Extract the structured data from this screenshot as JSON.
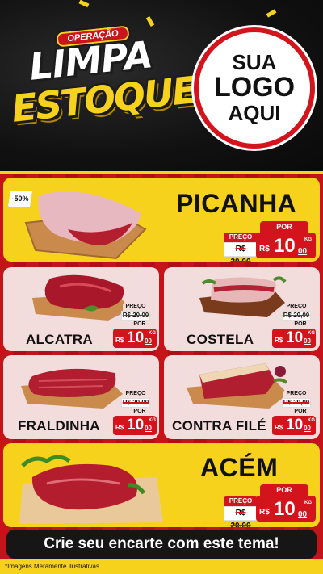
{
  "header": {
    "badge": "OPERAÇÃO",
    "title_line1": "LIMPA",
    "title_line2": "ESTOQUE",
    "logo_line1": "SUA",
    "logo_line2": "LOGO",
    "logo_line3": "AQUI"
  },
  "discount_badge": "-50%",
  "products": [
    {
      "name": "PICANHA",
      "preco_label": "PREÇO",
      "old_price": "R$ 20,00",
      "por_label": "POR",
      "currency": "R$",
      "price_int": "10",
      "price_cents": "00",
      "unit": "KG"
    },
    {
      "name": "ALCATRA",
      "preco_label": "PREÇO",
      "old_price": "R$ 20,00",
      "por_label": "POR",
      "currency": "R$",
      "price_int": "10",
      "price_cents": "00",
      "unit": "KG"
    },
    {
      "name": "COSTELA",
      "preco_label": "PREÇO",
      "old_price": "R$ 20,00",
      "por_label": "POR",
      "currency": "R$",
      "price_int": "10",
      "price_cents": "00",
      "unit": "KG"
    },
    {
      "name": "FRALDINHA",
      "preco_label": "PREÇO",
      "old_price": "R$ 20,00",
      "por_label": "POR",
      "currency": "R$",
      "price_int": "10",
      "price_cents": "00",
      "unit": "KG"
    },
    {
      "name": "CONTRA FILÉ",
      "preco_label": "PREÇO",
      "old_price": "R$ 20,00",
      "por_label": "POR",
      "currency": "R$",
      "price_int": "10",
      "price_cents": "00",
      "unit": "KG"
    },
    {
      "name": "ACÉM",
      "preco_label": "PREÇO",
      "old_price": "R$ 20,00",
      "por_label": "POR",
      "currency": "R$",
      "price_int": "10",
      "price_cents": "00",
      "unit": "KG"
    }
  ],
  "cta": "Crie seu encarte com este tema!",
  "disclaimer": "*Imagens Meramente Ilustrativas",
  "colors": {
    "brand_red": "#d3141c",
    "brand_yellow": "#f7d21c",
    "dark": "#161616"
  }
}
